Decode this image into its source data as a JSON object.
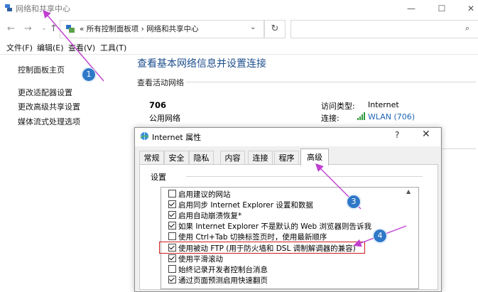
{
  "window": {
    "title": "网络和共享中心",
    "minimize": "—",
    "maximize": "☐",
    "close": "✕"
  },
  "address": {
    "back": "←",
    "forward": "→",
    "recent": "⌄",
    "up": "↑",
    "path": "«  所有控制面板项  ›  网络和共享中心",
    "dropdown": "⌄",
    "refresh": "↻",
    "search_placeholder": "",
    "search_icon": "⌕"
  },
  "menu": {
    "file": "文件(F)",
    "edit": "编辑(E)",
    "view": "查看(V)",
    "tools": "工具(T)"
  },
  "sidebar": {
    "items": [
      {
        "label": "控制面板主页"
      },
      {
        "label": "更改适配器设置"
      },
      {
        "label": "更改高级共享设置"
      },
      {
        "label": "媒体流式处理选项"
      }
    ]
  },
  "main": {
    "title": "查看基本网络信息并设置连接",
    "active_section": "查看活动网络",
    "network_name": "706",
    "network_type": "公用网络",
    "access_type_label": "访问类型:",
    "access_type_value": "Internet",
    "connection_label": "连接:",
    "connection_value": "WLAN (706)"
  },
  "dialog": {
    "title": "Internet 属性",
    "help": "?",
    "close": "✕",
    "tabs": [
      "常规",
      "安全",
      "隐私",
      "内容",
      "连接",
      "程序",
      "高级"
    ],
    "active_tab": "高级",
    "settings_label": "设置",
    "items": [
      {
        "label": "启用建议的网站",
        "checked": false
      },
      {
        "label": "启用同步 Internet Explorer 设置和数据",
        "checked": true
      },
      {
        "label": "启用自动崩溃恢复*",
        "checked": true
      },
      {
        "label": "如果 Internet Explorer 不是默认的 Web 浏览器则告诉我",
        "checked": true
      },
      {
        "label": "使用 Ctrl+Tab 切换标签页时，使用最新顺序",
        "checked": false
      },
      {
        "label": "使用被动 FTP (用于防火墙和 DSL 调制解调器的兼容)",
        "checked": true
      },
      {
        "label": "使用平滑滚动",
        "checked": true
      },
      {
        "label": "始终记录开发者控制台消息",
        "checked": false
      },
      {
        "label": "通过页面预测启用快速翻页",
        "checked": true
      }
    ]
  },
  "annotations": {
    "step1": "1",
    "step3": "3",
    "step4": "4",
    "badge_color": "#2f78c8",
    "arrow_color": "#c040d0",
    "highlight_color": "#d01c1c"
  }
}
